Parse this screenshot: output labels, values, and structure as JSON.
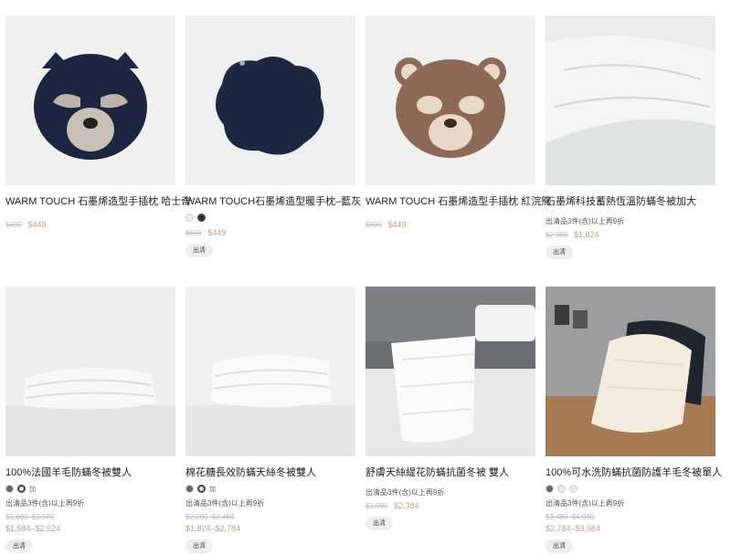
{
  "products": [
    {
      "title": "WARM TOUCH 石墨烯造型手插枕 哈士奇",
      "original_price": "$699",
      "price": "$449",
      "swatches": [],
      "promo": "",
      "badge": ""
    },
    {
      "title": "WARM TOUCH石墨烯造型暖手枕–藍灰",
      "original_price": "$699",
      "price": "$449",
      "swatches": [
        "#f0f0f0",
        "#1e2a40"
      ],
      "promo": "",
      "badge": "出清"
    },
    {
      "title": "WARM TOUCH 石墨烯造型手插枕 紅浣熊",
      "original_price": "$699",
      "price": "$449",
      "swatches": [],
      "promo": "",
      "badge": ""
    },
    {
      "title": "石墨烯科技蓄熱恆溫防蟎冬被加大",
      "original_price": "$2,980",
      "price": "$1,824",
      "swatches": [],
      "promo": "出清品3件(含)以上再9折",
      "badge": "出清"
    },
    {
      "title": "100%法國羊毛防蟎冬被雙人",
      "original_price": "$1,680–$2,980",
      "price": "$1,584–$2,624",
      "swatches": [
        "#666666",
        "#dddddd"
      ],
      "swatch_text": "加",
      "promo": "出清品3件(含)以上再9折",
      "badge": "出清"
    },
    {
      "title": "棉花糖長效防蟎天絲冬被雙人",
      "original_price": "$2,280–$3,480",
      "price": "$1,824–$2,784",
      "swatches": [
        "#666666",
        "#dddddd"
      ],
      "swatch_text": "加",
      "promo": "出清品3件(含)以上再9折",
      "badge": "出清"
    },
    {
      "title": "舒膚天絲緹花防蟎抗菌冬被 雙人",
      "original_price": "$2,980",
      "price": "$2,384",
      "swatches": [],
      "promo": "出清品3件(含)以上再9折",
      "badge": "出清"
    },
    {
      "title": "100%可水洗防蟎抗菌防護羊毛冬被單人",
      "original_price": "$3,480–$4,980",
      "price": "$2,784–$3,984",
      "swatches": [
        "#666666",
        "#e8e8e8",
        "#e8e8e8"
      ],
      "swatch_text": "",
      "promo": "出清品3件(含)以上再9折",
      "badge": "出清"
    }
  ]
}
